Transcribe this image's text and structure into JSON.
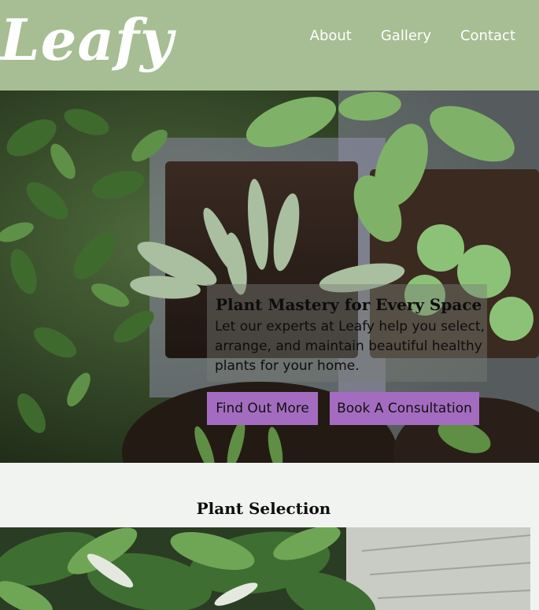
{
  "header": {
    "logo_text": "Leafy",
    "nav": [
      {
        "label": "About"
      },
      {
        "label": "Gallery"
      },
      {
        "label": "Contact"
      }
    ]
  },
  "hero": {
    "title": "Plant Mastery for Every Space",
    "text": "Let our experts at Leafy help you select, arrange, and maintain beautiful healthy plants for your home.",
    "buttons": [
      {
        "label": "Find Out More"
      },
      {
        "label": "Book A Consultation"
      }
    ]
  },
  "selection": {
    "title": "Plant Selection"
  },
  "colors": {
    "header_bg": "#a7bd93",
    "button_bg": "#a46cc0",
    "page_bg": "#f1f3f1"
  }
}
